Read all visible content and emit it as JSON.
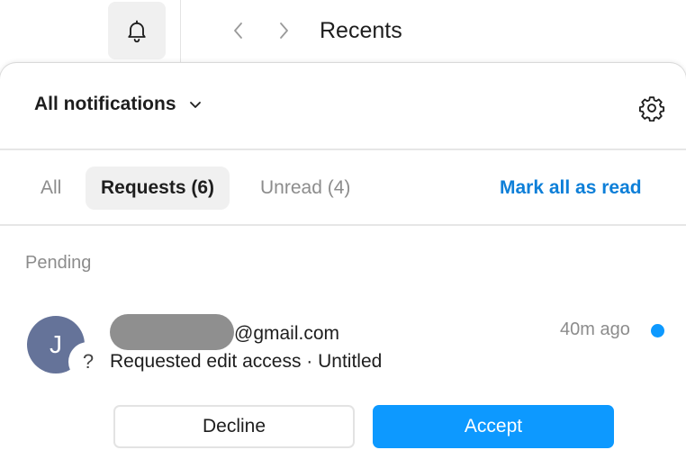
{
  "topbar": {
    "title": "Recents",
    "icons": {
      "bell": "bell-icon",
      "back": "chevron-left-icon",
      "forward": "chevron-right-icon"
    }
  },
  "panel": {
    "filter_label": "All notifications",
    "tabs": [
      {
        "label": "All",
        "selected": false
      },
      {
        "label": "Requests (6)",
        "selected": true
      },
      {
        "label": "Unread (4)",
        "selected": false
      }
    ],
    "mark_all_read": "Mark all as read",
    "section_label": "Pending"
  },
  "notification": {
    "avatar_initial": "J",
    "badge_glyph": "?",
    "sender_email": "@gmail.com",
    "message": "Requested edit access · Untitled",
    "time": "40m ago",
    "unread": true,
    "decline_label": "Decline",
    "accept_label": "Accept"
  },
  "colors": {
    "accent": "#0d99ff",
    "link": "#0d7fd8",
    "avatar": "#657399",
    "muted_text": "#8c8c8c"
  }
}
